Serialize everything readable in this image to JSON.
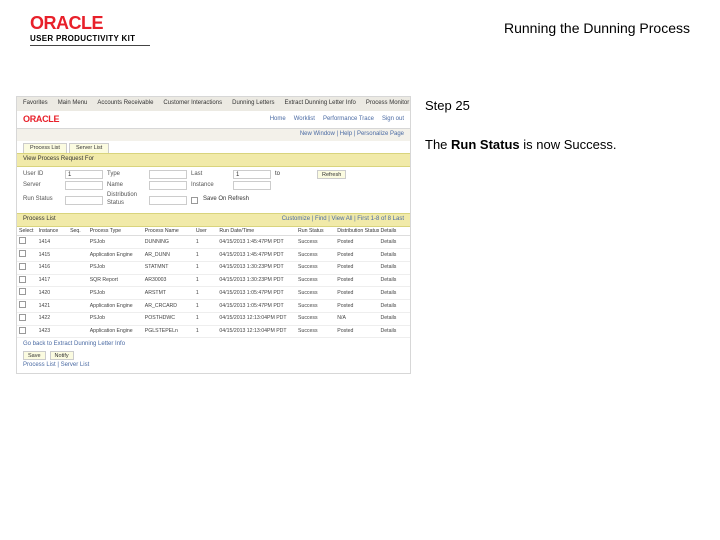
{
  "header": {
    "brand_name": "ORACLE",
    "brand_suffix": "USER PRODUCTIVITY KIT",
    "title": "Running the Dunning Process"
  },
  "side": {
    "step_label": "Step 25",
    "desc_prefix": "The ",
    "desc_bold": "Run Status",
    "desc_suffix": " is now Success."
  },
  "shot": {
    "nav": [
      "Favorites",
      "Main Menu",
      "Accounts Receivable",
      "Customer Interactions",
      "Dunning Letters",
      "Extract Dunning Letter Info",
      "Process Monitor"
    ],
    "brand_small": "ORACLE",
    "brand_right": [
      "Home",
      "Worklist",
      "Performance Trace",
      "Sign out"
    ],
    "sub_bar": "New Window | Help | Personalize Page",
    "tabs": [
      "Process List",
      "Server List"
    ],
    "section1": "View Process Request For",
    "form": {
      "user_lbl": "User ID",
      "user_val": "1",
      "type_lbl": "Type",
      "type_val": "",
      "last_lbl": "Last",
      "last_val": "1",
      "to_val": "to",
      "refresh": "Refresh",
      "server_lbl": "Server",
      "server_val": "",
      "name_lbl": "Name",
      "name_val": "",
      "instance_lbl": "Instance",
      "instance_val": "",
      "runstatus_lbl": "Run Status",
      "runstatus_val": "",
      "diststatus_lbl": "Distribution Status",
      "diststatus_val": "",
      "save_cb": "Save On Refresh"
    },
    "section2": "Process List",
    "paging": "Customize | Find | View All |  First 1-8 of 8 Last",
    "cols": [
      "Select",
      "Instance",
      "Seq.",
      "Process Type",
      "Process Name",
      "User",
      "Run Date/Time",
      "Run Status",
      "Distribution Status",
      "Details"
    ],
    "rows": [
      [
        "",
        "1414",
        "",
        "PSJob",
        "DUNNING",
        "1",
        "04/15/2013 1:45:47PM PDT",
        "Success",
        "Posted",
        "Details"
      ],
      [
        "",
        "1415",
        "",
        "Application Engine",
        "AR_DUNN",
        "1",
        "04/15/2013 1:45:47PM PDT",
        "Success",
        "Posted",
        "Details"
      ],
      [
        "",
        "1416",
        "",
        "PSJob",
        "STATMNT",
        "1",
        "04/15/2013 1:30:23PM PDT",
        "Success",
        "Posted",
        "Details"
      ],
      [
        "",
        "1417",
        "",
        "SQR Report",
        "AR30003",
        "1",
        "04/15/2013 1:30:23PM PDT",
        "Success",
        "Posted",
        "Details"
      ],
      [
        "",
        "1420",
        "",
        "PSJob",
        "ARSTMT",
        "1",
        "04/15/2013 1:05:47PM PDT",
        "Success",
        "Posted",
        "Details"
      ],
      [
        "",
        "1421",
        "",
        "Application Engine",
        "AR_CRCARD",
        "1",
        "04/15/2013 1:05:47PM PDT",
        "Success",
        "Posted",
        "Details"
      ],
      [
        "",
        "1422",
        "",
        "PSJob",
        "POSTHDWC",
        "1",
        "04/15/2013 12:13:04PM PDT",
        "Success",
        "N/A",
        "Details"
      ],
      [
        "",
        "1423",
        "",
        "Application Engine",
        "PGLSTEPELn",
        "1",
        "04/15/2013 12:13:04PM PDT",
        "Success",
        "Posted",
        "Details"
      ]
    ],
    "back_link": "Go back to Extract Dunning Letter Info",
    "save_btn": "Save",
    "notify_btn": "Notify",
    "foot_link": "Process List | Server List"
  }
}
